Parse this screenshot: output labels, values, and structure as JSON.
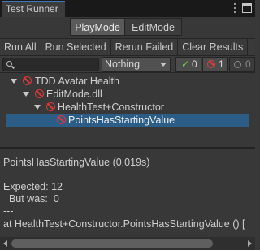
{
  "window": {
    "tab_title": "Test Runner",
    "icons": [
      "kebab-menu-icon",
      "maximize-icon"
    ]
  },
  "modes": {
    "play": "PlayMode",
    "edit": "EditMode",
    "active": "PlayMode"
  },
  "toolbar": {
    "run_all": "Run All",
    "run_selected": "Run Selected",
    "rerun_failed": "Rerun Failed",
    "clear_results": "Clear Results"
  },
  "filter": {
    "search_value": "",
    "dropdown_value": "Nothing",
    "passed_count": "0",
    "failed_count": "1",
    "skipped_count": "0"
  },
  "tree": [
    {
      "label": "TDD Avatar Health",
      "status": "failed",
      "expanded": true
    },
    {
      "label": "EditMode.dll",
      "status": "failed",
      "expanded": true
    },
    {
      "label": "HealthTest+Constructor",
      "status": "failed",
      "expanded": true
    },
    {
      "label": "PointsHasStartingValue",
      "status": "failed",
      "selected": true
    }
  ],
  "details": {
    "lines": [
      "PointsHasStartingValue (0,019s)",
      "---",
      "Expected: 12",
      "  But was:  0",
      "---",
      "at HealthTest+Constructor.PointsHasStartingValue () ["
    ]
  },
  "colors": {
    "selection": "#2c5d87",
    "fail": "#e03737",
    "pass": "#6cd44a",
    "tab_accent": "#3a79bb"
  }
}
